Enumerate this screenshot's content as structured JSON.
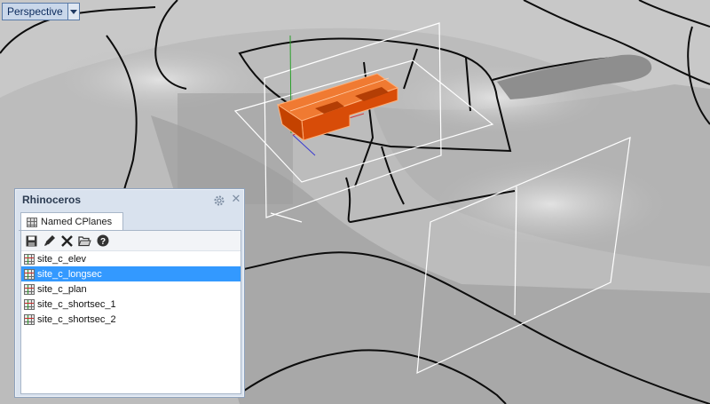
{
  "viewport": {
    "title": "Perspective",
    "background": "#bcbcbc",
    "highlight_color": "#e85a10"
  },
  "panel": {
    "title": "Rhinoceros",
    "tab_label": "Named CPlanes",
    "toolbar": {
      "save_icon": "save-icon",
      "edit_icon": "edit-icon",
      "delete_icon": "delete-icon",
      "open_icon": "folder-open-icon",
      "help_icon": "help-icon"
    },
    "items": [
      {
        "label": "site_c_elev",
        "selected": false
      },
      {
        "label": "site_c_longsec",
        "selected": true
      },
      {
        "label": "site_c_plan",
        "selected": false
      },
      {
        "label": "site_c_shortsec_1",
        "selected": false
      },
      {
        "label": "site_c_shortsec_2",
        "selected": false
      }
    ],
    "selection_color": "#3399ff"
  }
}
